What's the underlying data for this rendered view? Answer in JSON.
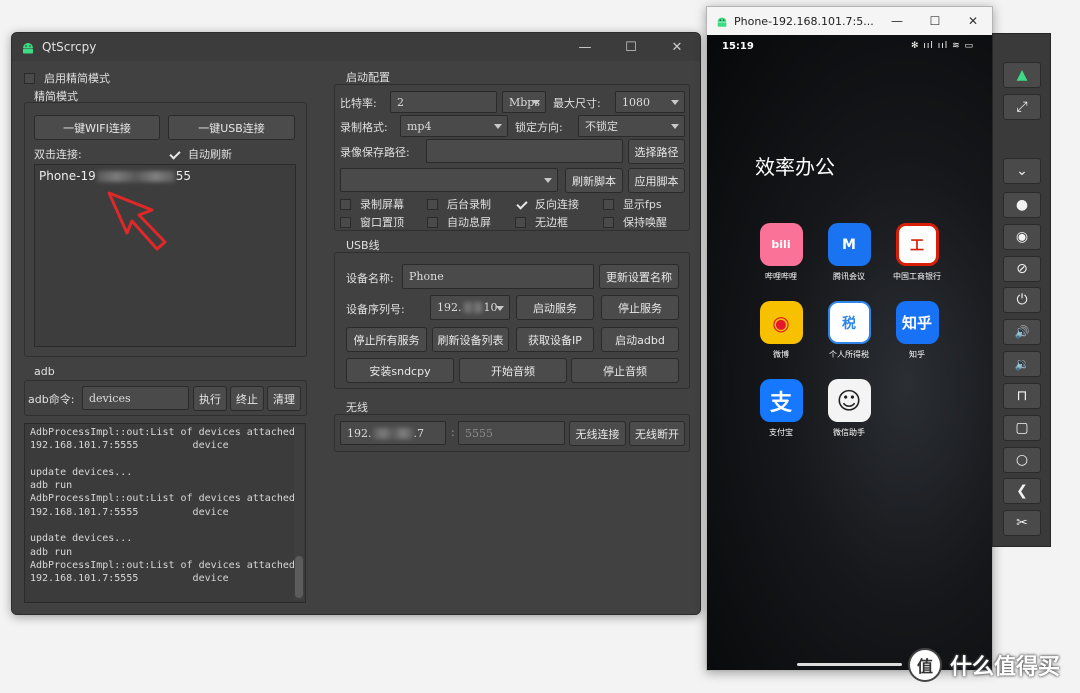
{
  "main_window": {
    "title": "QtScrcpy",
    "controls": {
      "minimize": "—",
      "maximize": "☐",
      "close": "✕"
    },
    "simple_mode_checkbox": {
      "label": "启用精简模式",
      "checked": false
    },
    "simple_group": {
      "title": "精简模式",
      "wifi_button": "一键WIFI连接",
      "usb_button": "一键USB连接",
      "double_click_label": "双击连接:",
      "auto_refresh": {
        "label": "自动刷新",
        "checked": true
      },
      "device_prefix": "Phone-19",
      "device_suffix": "55"
    },
    "adb_group": {
      "title": "adb",
      "command_label": "adb命令:",
      "command_value": "devices",
      "exec_button": "执行",
      "stop_button": "终止",
      "clear_button": "清理",
      "log": "AdbProcessImpl::out:List of devices attached\n192.168.101.7:5555         device\n\nupdate devices...\nadb run\nAdbProcessImpl::out:List of devices attached\n192.168.101.7:5555         device\n\nupdate devices...\nadb run\nAdbProcessImpl::out:List of devices attached\n192.168.101.7:5555         device"
    },
    "launch_group": {
      "title": "启动配置",
      "bitrate_label": "比特率:",
      "bitrate_value": "2",
      "bitrate_unit": "Mbps",
      "max_size_label": "最大尺寸:",
      "max_size_value": "1080",
      "record_format_label": "录制格式:",
      "record_format_value": "mp4",
      "lock_orientation_label": "锁定方向:",
      "lock_orientation_value": "不锁定",
      "record_path_label": "录像保存路径:",
      "record_path_value": "",
      "select_path_button": "选择路径",
      "script_value": "",
      "refresh_script_button": "刷新脚本",
      "apply_script_button": "应用脚本",
      "options": [
        {
          "label": "录制屏幕",
          "checked": false
        },
        {
          "label": "后台录制",
          "checked": false
        },
        {
          "label": "反向连接",
          "checked": true
        },
        {
          "label": "显示fps",
          "checked": false
        },
        {
          "label": "窗口置顶",
          "checked": false
        },
        {
          "label": "自动息屏",
          "checked": false
        },
        {
          "label": "无边框",
          "checked": false
        },
        {
          "label": "保持唤醒",
          "checked": false
        }
      ]
    },
    "usb_group": {
      "title": "USB线",
      "device_name_label": "设备名称:",
      "device_name_value": "Phone",
      "update_name_button": "更新设置名称",
      "serial_label": "设备序列号:",
      "serial_prefix": "192.",
      "serial_suffix": "10",
      "start_service_button": "启动服务",
      "stop_service_button": "停止服务",
      "stop_all_button": "停止所有服务",
      "refresh_list_button": "刷新设备列表",
      "get_ip_button": "获取设备IP",
      "start_adbd_button": "启动adbd",
      "install_sndcpy_button": "安装sndcpy",
      "start_audio_button": "开始音频",
      "stop_audio_button": "停止音频"
    },
    "wireless_group": {
      "title": "无线",
      "ip_prefix": "192.",
      "ip_suffix": ".7",
      "colon": ":",
      "port_value": "5555",
      "connect_button": "无线连接",
      "disconnect_button": "无线断开"
    }
  },
  "phone_window": {
    "title": "Phone-192.168.101.7:5...",
    "controls": {
      "minimize": "—",
      "maximize": "☐",
      "close": "✕"
    },
    "status_time": "15:19",
    "status_icons": "✻ ııl ııl ≋ ▭",
    "folder_title": "效率办公",
    "apps": [
      {
        "name": "哔哩哔哩",
        "glyph": "bili",
        "color": "#fb7299"
      },
      {
        "name": "腾讯会议",
        "glyph": "M",
        "color": "#1a73f0"
      },
      {
        "name": "中国工商银行",
        "glyph": "工",
        "color": "#d81e06"
      },
      {
        "name": "微博",
        "glyph": "◉",
        "color": "#f7c100"
      },
      {
        "name": "个人所得税",
        "glyph": "税",
        "color": "#2f86e8"
      },
      {
        "name": "知乎",
        "glyph": "知乎",
        "color": "#1772f6"
      },
      {
        "name": "支付宝",
        "glyph": "支",
        "color": "#1677ff"
      },
      {
        "name": "微信助手",
        "glyph": "☺",
        "color": "#f4f4f4"
      }
    ]
  },
  "side_toolbar": {
    "buttons": [
      {
        "name": "android-icon",
        "glyph": "▲",
        "color": "#3ddc84"
      },
      {
        "name": "fullscreen-icon",
        "glyph": "⤢",
        "color": "#f2f2f2"
      },
      {
        "name": "expand-notification-icon",
        "glyph": "⌄",
        "color": "#f2f2f2"
      },
      {
        "name": "record-icon",
        "glyph": "●",
        "color": "#f2f2f2"
      },
      {
        "name": "screen-on-icon",
        "glyph": "◉",
        "color": "#f2f2f2"
      },
      {
        "name": "screen-off-icon",
        "glyph": "⊘",
        "color": "#f2f2f2"
      },
      {
        "name": "power-icon",
        "glyph": "⏻",
        "color": "#f2f2f2"
      },
      {
        "name": "volume-up-icon",
        "glyph": "🔊",
        "color": "#f2f2f2"
      },
      {
        "name": "volume-down-icon",
        "glyph": "🔉",
        "color": "#f2f2f2"
      },
      {
        "name": "app-switch-icon",
        "glyph": "⊓",
        "color": "#f2f2f2"
      },
      {
        "name": "menu-icon",
        "glyph": "▢",
        "color": "#f2f2f2"
      },
      {
        "name": "home-icon",
        "glyph": "○",
        "color": "#f2f2f2"
      },
      {
        "name": "back-icon",
        "glyph": "❮",
        "color": "#f2f2f2"
      },
      {
        "name": "screenshot-icon",
        "glyph": "✂",
        "color": "#f2f2f2"
      }
    ]
  },
  "watermark": {
    "glyph": "值",
    "text": "什么值得买"
  }
}
